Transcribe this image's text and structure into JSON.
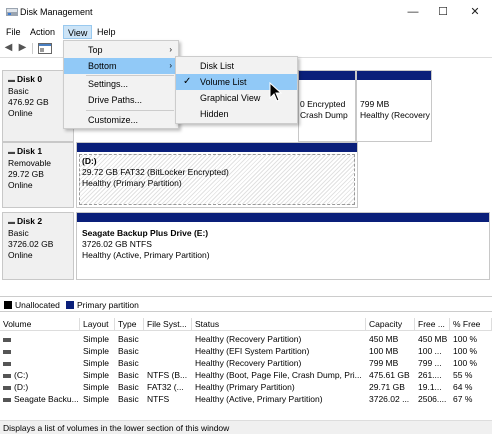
{
  "window": {
    "title": "Disk Management",
    "minimize": "—",
    "maximize": "☐",
    "close": "✕"
  },
  "menubar": {
    "items": [
      "File",
      "Action",
      "View",
      "Help"
    ]
  },
  "view_menu": {
    "items": [
      {
        "label": "Top",
        "arrow": "›"
      },
      {
        "label": "Bottom",
        "arrow": "›"
      },
      {
        "label": "Settings..."
      },
      {
        "label": "Drive Paths..."
      },
      {
        "label": "Customize..."
      }
    ]
  },
  "bottom_submenu": {
    "items": [
      {
        "label": "Disk List"
      },
      {
        "label": "Volume List",
        "checked": "✓"
      },
      {
        "label": "Graphical View"
      },
      {
        "label": "Hidden"
      }
    ]
  },
  "disks": [
    {
      "name": "Disk 0",
      "type": "Basic",
      "size": "476.92 GB",
      "status": "Online",
      "partial_volumes": [
        {
          "line1": "0 Encrypted",
          "line2": "Crash Dump"
        },
        {
          "line1": "799 MB",
          "line2": "Healthy (Recovery"
        }
      ]
    },
    {
      "name": "Disk 1",
      "type": "Removable",
      "size": "29.72 GB",
      "status": "Online",
      "volume": {
        "name": "(D:)",
        "detail": "29.72 GB FAT32 (BitLocker Encrypted)",
        "health": "Healthy (Primary Partition)"
      }
    },
    {
      "name": "Disk 2",
      "type": "Basic",
      "size": "3726.02 GB",
      "status": "Online",
      "volume": {
        "name": "Seagate Backup Plus Drive  (E:)",
        "detail": "3726.02 GB NTFS",
        "health": "Healthy (Active, Primary Partition)"
      }
    }
  ],
  "legend": {
    "unallocated": "Unallocated",
    "primary": "Primary partition"
  },
  "colors": {
    "primary": "#0a1f7a",
    "unallocated": "#000000",
    "highlight": "#91c9f7"
  },
  "table": {
    "headers": [
      "Volume",
      "Layout",
      "Type",
      "File Syst...",
      "Status",
      "Capacity",
      "Free ...",
      "% Free"
    ],
    "rows": [
      [
        "",
        "Simple",
        "Basic",
        "",
        "Healthy (Recovery Partition)",
        "450 MB",
        "450 MB",
        "100 %"
      ],
      [
        "",
        "Simple",
        "Basic",
        "",
        "Healthy (EFI System Partition)",
        "100 MB",
        "100 ...",
        "100 %"
      ],
      [
        "",
        "Simple",
        "Basic",
        "",
        "Healthy (Recovery Partition)",
        "799 MB",
        "799 ...",
        "100 %"
      ],
      [
        "(C:)",
        "Simple",
        "Basic",
        "NTFS (B...",
        "Healthy (Boot, Page File, Crash Dump, Pri...",
        "475.61 GB",
        "261....",
        "55 %"
      ],
      [
        "(D:)",
        "Simple",
        "Basic",
        "FAT32 (...",
        "Healthy (Primary Partition)",
        "29.71 GB",
        "19.1...",
        "64 %"
      ],
      [
        "Seagate Backu...",
        "Simple",
        "Basic",
        "NTFS",
        "Healthy (Active, Primary Partition)",
        "3726.02 ...",
        "2506....",
        "67 %"
      ]
    ]
  },
  "status_bar": "Displays a list of volumes in the lower section of this window"
}
